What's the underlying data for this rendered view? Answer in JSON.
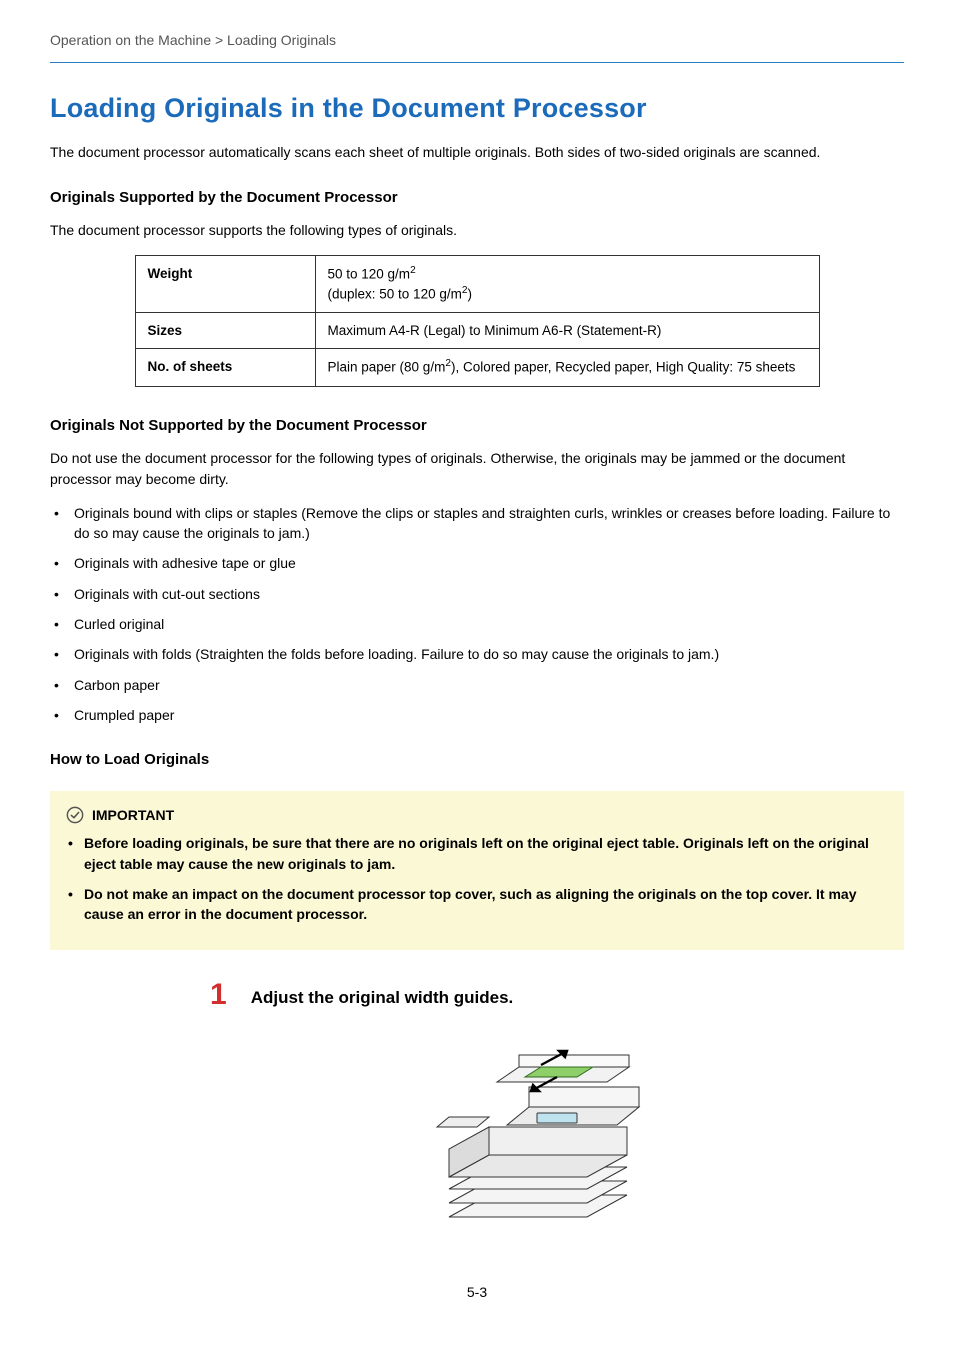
{
  "breadcrumb": "Operation on the Machine > Loading Originals",
  "title": "Loading Originals in the Document Processor",
  "intro": "The document processor automatically scans each sheet of multiple originals. Both sides of two-sided originals are scanned.",
  "section_supported": {
    "heading": "Originals Supported by the Document Processor",
    "lead": "The document processor supports the following types of originals.",
    "table": {
      "rows": [
        {
          "label": "Weight",
          "value_pre": "50 to 120 g/m",
          "value_post": "(duplex: 50 to 120 g/m",
          "value_tail": ")"
        },
        {
          "label": "Sizes",
          "value": "Maximum A4-R (Legal) to Minimum A6-R (Statement-R)"
        },
        {
          "label": "No. of sheets",
          "value_pre2": "Plain paper (80 g/m",
          "value_post2": "), Colored paper, Recycled paper, High Quality: 75 sheets"
        }
      ]
    }
  },
  "section_not_supported": {
    "heading": "Originals Not Supported by the Document Processor",
    "lead": "Do not use the document processor for the following types of originals. Otherwise, the originals may be jammed or the document processor may become dirty.",
    "items": [
      "Originals bound with clips or staples (Remove the clips or staples and straighten curls, wrinkles or creases before loading. Failure to do so may cause the originals to jam.)",
      "Originals with adhesive tape or glue",
      "Originals with cut-out sections",
      "Curled original",
      "Originals with folds (Straighten the folds before loading. Failure to do so may cause the originals to jam.)",
      "Carbon paper",
      "Crumpled paper"
    ]
  },
  "section_howto": {
    "heading": "How to Load Originals"
  },
  "important": {
    "label": "IMPORTANT",
    "items": [
      "Before loading originals, be sure that there are no originals left on the original eject table. Originals left on the original eject table may cause the new originals to jam.",
      "Do not make an impact on the document processor top cover, such as aligning the originals on the top cover. It may cause an error in the document processor."
    ]
  },
  "step1": {
    "num": "1",
    "title": "Adjust the original width guides."
  },
  "page_number": "5-3"
}
